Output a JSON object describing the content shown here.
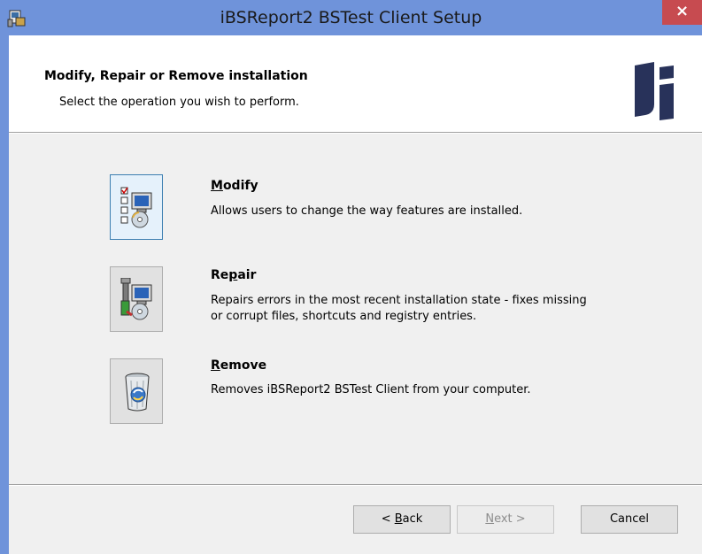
{
  "window": {
    "title": "iBSReport2 BSTest Client Setup",
    "close_label": "×"
  },
  "banner": {
    "title": "Modify, Repair or Remove installation",
    "subtitle": "Select the operation you wish to perform."
  },
  "options": [
    {
      "title_prefix": "",
      "title_key": "M",
      "title_rest": "odify",
      "description": "Allows users to change the way features are installed.",
      "icon": "modify-icon"
    },
    {
      "title_prefix": "Re",
      "title_key": "p",
      "title_rest": "air",
      "description": "Repairs errors in the most recent installation state - fixes missing or corrupt files, shortcuts and registry entries.",
      "icon": "repair-icon"
    },
    {
      "title_prefix": "",
      "title_key": "R",
      "title_rest": "emove",
      "description": "Removes iBSReport2 BSTest Client from your computer.",
      "icon": "remove-icon"
    }
  ],
  "footer": {
    "back_prefix": "< ",
    "back_key": "B",
    "back_rest": "ack",
    "next_key": "N",
    "next_rest": "ext >",
    "cancel": "Cancel"
  },
  "colors": {
    "title_bar": "#6f93da",
    "close_button": "#c74b50",
    "client_background": "#f0f0f0",
    "banner_background": "#ffffff"
  }
}
